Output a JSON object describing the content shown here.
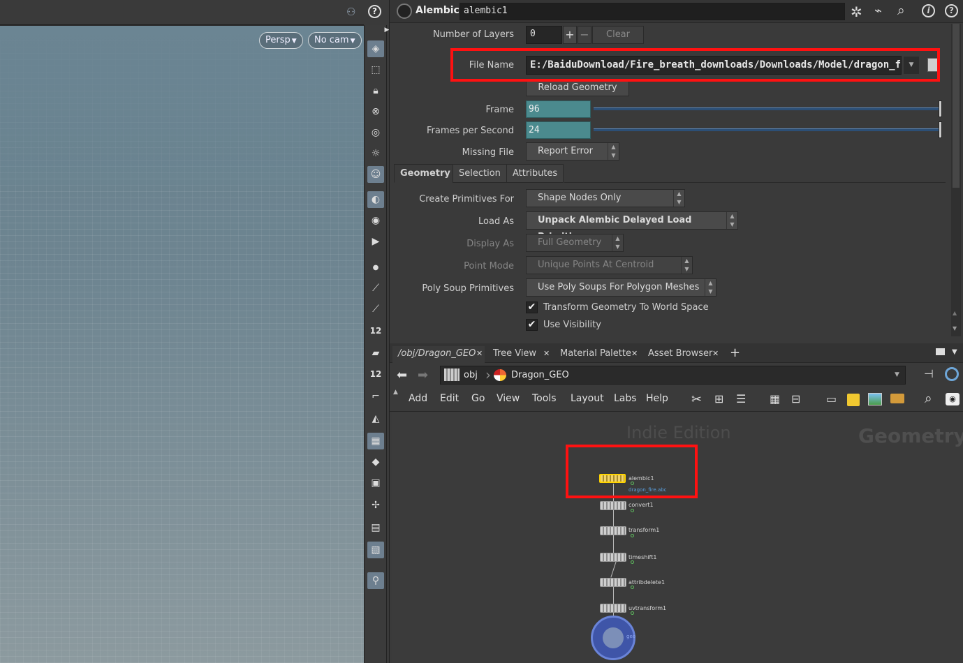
{
  "viewport": {
    "persp_label": "Persp",
    "cam_label": "No cam"
  },
  "params": {
    "node_type": "Alembic",
    "node_name": "alembic1",
    "num_layers_label": "Number of Layers",
    "num_layers_value": "0",
    "clear_label": "Clear",
    "file_name_label": "File Name",
    "file_name_value": "E:/BaiduDownload/Fire_breath_downloads/Downloads/Model/dragon_fire.abc",
    "reload_label": "Reload Geometry",
    "frame_label": "Frame",
    "frame_value": "96",
    "fps_label": "Frames per Second",
    "fps_value": "24",
    "missing_file_label": "Missing File",
    "missing_file_value": "Report Error",
    "tabs": [
      "Geometry",
      "Selection",
      "Attributes"
    ],
    "create_prims_label": "Create Primitives For",
    "create_prims_value": "Shape Nodes Only",
    "load_as_label": "Load As",
    "load_as_value": "Unpack Alembic Delayed Load Primitives",
    "display_as_label": "Display As",
    "display_as_value": "Full Geometry",
    "point_mode_label": "Point Mode",
    "point_mode_value": "Unique Points At Centroid",
    "poly_soup_label": "Poly Soup Primitives",
    "poly_soup_value": "Use Poly Soups For Polygon Meshes",
    "transform_label": "Transform Geometry To World Space",
    "visibility_label": "Use Visibility"
  },
  "network": {
    "pane_tabs": [
      "/obj/Dragon_GEO",
      "Tree View",
      "Material Palette",
      "Asset Browser"
    ],
    "path_obj": "obj",
    "path_geo": "Dragon_GEO",
    "menu": [
      "Add",
      "Edit",
      "Go",
      "View",
      "Tools",
      "Layout",
      "Labs",
      "Help"
    ],
    "watermark_edition": "Indie Edition",
    "watermark_context": "Geometry",
    "nodes": [
      {
        "name": "alembic1",
        "sub": "dragon_fire.abc"
      },
      {
        "name": "convert1"
      },
      {
        "name": "transform1"
      },
      {
        "name": "timeshift1"
      },
      {
        "name": "attribdelete1"
      },
      {
        "name": "uvtransform1"
      },
      {
        "name": "geo"
      }
    ]
  }
}
